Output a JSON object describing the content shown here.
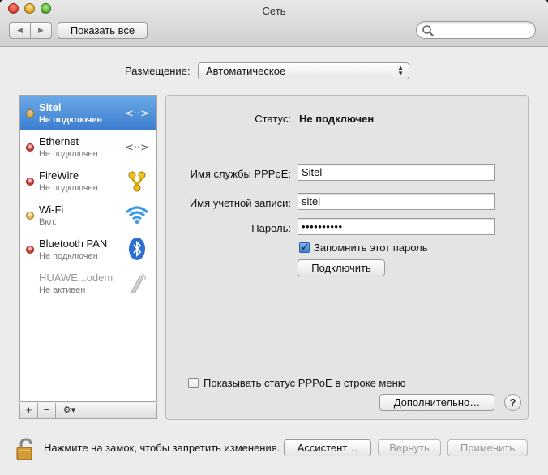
{
  "window": {
    "title": "Сеть",
    "show_all": "Показать все",
    "back_glyph": "◀",
    "forward_glyph": "▶",
    "search_placeholder": ""
  },
  "location": {
    "label": "Размещение:",
    "value": "Автоматическое"
  },
  "services": [
    {
      "name": "Sitel",
      "status": "Не подключен",
      "dot_color": "#f1b23a",
      "icon": "ethernet-icon",
      "selected": true
    },
    {
      "name": "Ethernet",
      "status": "Не подключен",
      "dot_color": "#d9322a",
      "icon": "ethernet-icon"
    },
    {
      "name": "FireWire",
      "status": "Не подключен",
      "dot_color": "#d9322a",
      "icon": "firewire-icon"
    },
    {
      "name": "Wi-Fi",
      "status": "Вкл.",
      "dot_color": "#f1b23a",
      "icon": "wifi-icon"
    },
    {
      "name": "Bluetooth PAN",
      "status": "Не подключен",
      "dot_color": "#d9322a",
      "icon": "bluetooth-icon"
    },
    {
      "name": "HUAWE...odem",
      "status": "Не активен",
      "dot_color": "",
      "icon": "modem-icon"
    }
  ],
  "sidebar_bar": {
    "add": "+",
    "remove": "−",
    "gear": "⚙▾"
  },
  "detail": {
    "status_label": "Статус:",
    "status_value": "Не подключен",
    "pppoe_name_label": "Имя службы PPPoE:",
    "pppoe_name_value": "Sitel",
    "account_label": "Имя учетной записи:",
    "account_value": "sitel",
    "password_label": "Пароль:",
    "password_value": "••••••••••",
    "remember_label": "Запомнить этот пароль",
    "remember_checked": true,
    "connect_button": "Подключить",
    "show_status_label": "Показывать статус PPPoE в строке меню",
    "show_status_checked": false,
    "advanced_button": "Дополнительно…",
    "help": "?"
  },
  "footer": {
    "lock_text": "Нажмите на замок, чтобы запретить изменения.",
    "assistant": "Ассистент…",
    "revert": "Вернуть",
    "apply": "Применить"
  }
}
